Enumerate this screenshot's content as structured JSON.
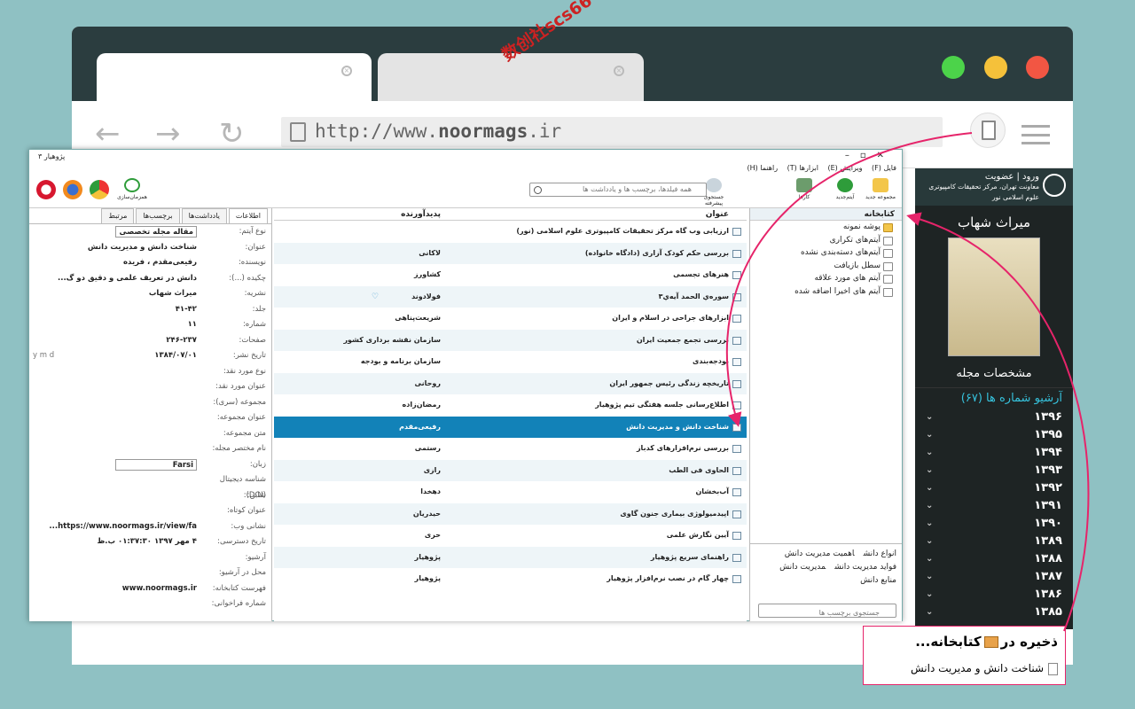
{
  "browser": {
    "url_prefix": "http://www.",
    "url_domain": "noormags",
    "url_tld": ".ir",
    "dot_colors": {
      "green": "#4cd34a",
      "yellow": "#f5c13a",
      "red": "#f25643"
    }
  },
  "watermark": "数创社scs66",
  "site": {
    "userbar_line1": "ورود | عضویت",
    "userbar_line2": "معاونت تهران، مرکز تحقیقات کامپیوتری علوم اسلامی نور",
    "magazine_title": "میراث شهاب",
    "specs_link": "مشخصات مجله",
    "archive_label": "آرشیو شماره ها (۶۷)",
    "years": [
      "۱۳۹۶",
      "۱۳۹۵",
      "۱۳۹۴",
      "۱۳۹۳",
      "۱۳۹۲",
      "۱۳۹۱",
      "۱۳۹۰",
      "۱۳۸۹",
      "۱۳۸۸",
      "۱۳۸۷",
      "۱۳۸۶",
      "۱۳۸۵"
    ]
  },
  "app": {
    "title": "پژوهیار ۳",
    "menu": [
      "فایل (F)",
      "ویرایش (E)",
      "ابزارها (T)",
      "راهنما (H)"
    ],
    "toolbar": {
      "new_collection": "مجموعه جدید",
      "new_item": "آیتم‌جدید",
      "actions": "کارها",
      "advanced_search": "جستجوی پیشرفته",
      "search_placeholder": "همه فیلدها، برچسب ها و یادداشت ها",
      "sync": "همزمان‌سازی"
    },
    "collections": {
      "root": "کتابخانه",
      "items": [
        "پوشه نمونه",
        "آیتم‌های تکراری",
        "آیتم‌های دسته‌بندی نشده",
        "سطل بازیافت",
        "آیتم های مورد علاقه",
        "آیتم های اخیرا اضافه شده"
      ]
    },
    "tags": {
      "items": [
        "انواع دانش",
        "اهمیت مدیریت دانش",
        "فواید مدیریت دانش",
        "مدیریت دانش",
        "منابع دانش"
      ],
      "search_placeholder": "جستجوی برچسب ها"
    },
    "items_header": {
      "title": "عنوان",
      "creator": "پدیدآورنده"
    },
    "items": [
      {
        "title": "ارزیابی وب گاه مرکز تحقیقات کامپیوتری علوم اسلامی (نور)",
        "creator": ""
      },
      {
        "title": "بررسی حکم کودک آزاری (دادگاه خانواده)",
        "creator": "لاکانی"
      },
      {
        "title": "هنرهای تجسمی",
        "creator": "کشاورز"
      },
      {
        "title": "سوره‌ي الحمد آيه‌ي۳",
        "creator": "فولادوند"
      },
      {
        "title": "ابزارهای جراحی در اسلام و ایران",
        "creator": "شریعت‌پناهی"
      },
      {
        "title": "بررسی تجمع جمعیت ایران",
        "creator": "سازمان نقشه برداری کشور"
      },
      {
        "title": "بودجه‌بندی",
        "creator": "سازمان برنامه و بودجه"
      },
      {
        "title": "تاریخچه زندگی رئیس جمهور ایران",
        "creator": "روحانی"
      },
      {
        "title": "اطلاع‌رسانی جلسه هفتگی تیم پژوهیار",
        "creator": "رمضان‌زاده"
      },
      {
        "title": "شناخت دانش و مدیریت دانش",
        "creator": "رفیعی‌مقدم"
      },
      {
        "title": "بررسی نرم‌افزارهای کدباز",
        "creator": "رستمی"
      },
      {
        "title": "الحاوی فی الطب",
        "creator": "رازی"
      },
      {
        "title": "آب‌بخشان",
        "creator": "دهخدا"
      },
      {
        "title": "اپیدمیولوژی بیماری جنون گاوی",
        "creator": "حیدریان"
      },
      {
        "title": "آیین نگارش علمی",
        "creator": "حری"
      },
      {
        "title": "راهنمای سریع پژوهیار",
        "creator": "پژوهیار"
      },
      {
        "title": "چهار گام در نصب نرم‌افزار پژوهیار",
        "creator": "پژوهیار"
      }
    ],
    "info_tabs": [
      "اطلاعات",
      "یادداشت‌ها",
      "برچسب‌ها",
      "مرتبط"
    ],
    "fields": [
      {
        "label": "نوع آیتم:",
        "value": "مقاله مجله تخصصی",
        "select": true
      },
      {
        "label": "عنوان:",
        "value": "شناخت دانش و مدیریت دانش"
      },
      {
        "label": "نویسنده:",
        "value": "رفیعی‌مقدم ، فریده"
      },
      {
        "label": "چکیده (...):",
        "value": "دانش در تعریف علمی و دقیق دو گ..."
      },
      {
        "label": "نشریه:",
        "value": "میراث شهاب"
      },
      {
        "label": "جلد:",
        "value": "۴۱-۴۲"
      },
      {
        "label": "شماره:",
        "value": "۱۱"
      },
      {
        "label": "صفحات:",
        "value": "۲۴۶-۲۳۷"
      },
      {
        "label": "تاریخ نشر:",
        "value": "۱۳۸۴/۰۷/۰۱",
        "extra": "y m d"
      },
      {
        "label": "نوع مورد نقد:",
        "value": ""
      },
      {
        "label": "عنوان مورد نقد:",
        "value": ""
      },
      {
        "label": "مجموعه (سری):",
        "value": ""
      },
      {
        "label": "عنوان مجموعه:",
        "value": ""
      },
      {
        "label": "متن مجموعه:",
        "value": ""
      },
      {
        "label": "نام مختصر مجله:",
        "value": ""
      },
      {
        "label": "زبان:",
        "value": "Farsi",
        "select": true
      },
      {
        "label": "شناسه دیجیتال (DOI):",
        "value": ""
      },
      {
        "label": "شابن:",
        "value": ""
      },
      {
        "label": "عنوان کوتاه:",
        "value": ""
      },
      {
        "label": "نشانی وب:",
        "value": "https://www.noormags.ir/view/fa..."
      },
      {
        "label": "تاریخ دسترسی:",
        "value": "۴ مهر ۱۳۹۷ ۰۱:۳۷:۳۰ ب.ظ"
      },
      {
        "label": "آرشیو:",
        "value": ""
      },
      {
        "label": "محل در آرشیو:",
        "value": ""
      },
      {
        "label": "فهرست کتابخانه:",
        "value": "www.noormags.ir"
      },
      {
        "label": "شماره فراخوانی:",
        "value": ""
      }
    ]
  },
  "callout": {
    "line1_a": "ذخیره در",
    "line1_b": "کتابخانه...",
    "line2": "شناخت دانش و مدیریت دانش"
  }
}
